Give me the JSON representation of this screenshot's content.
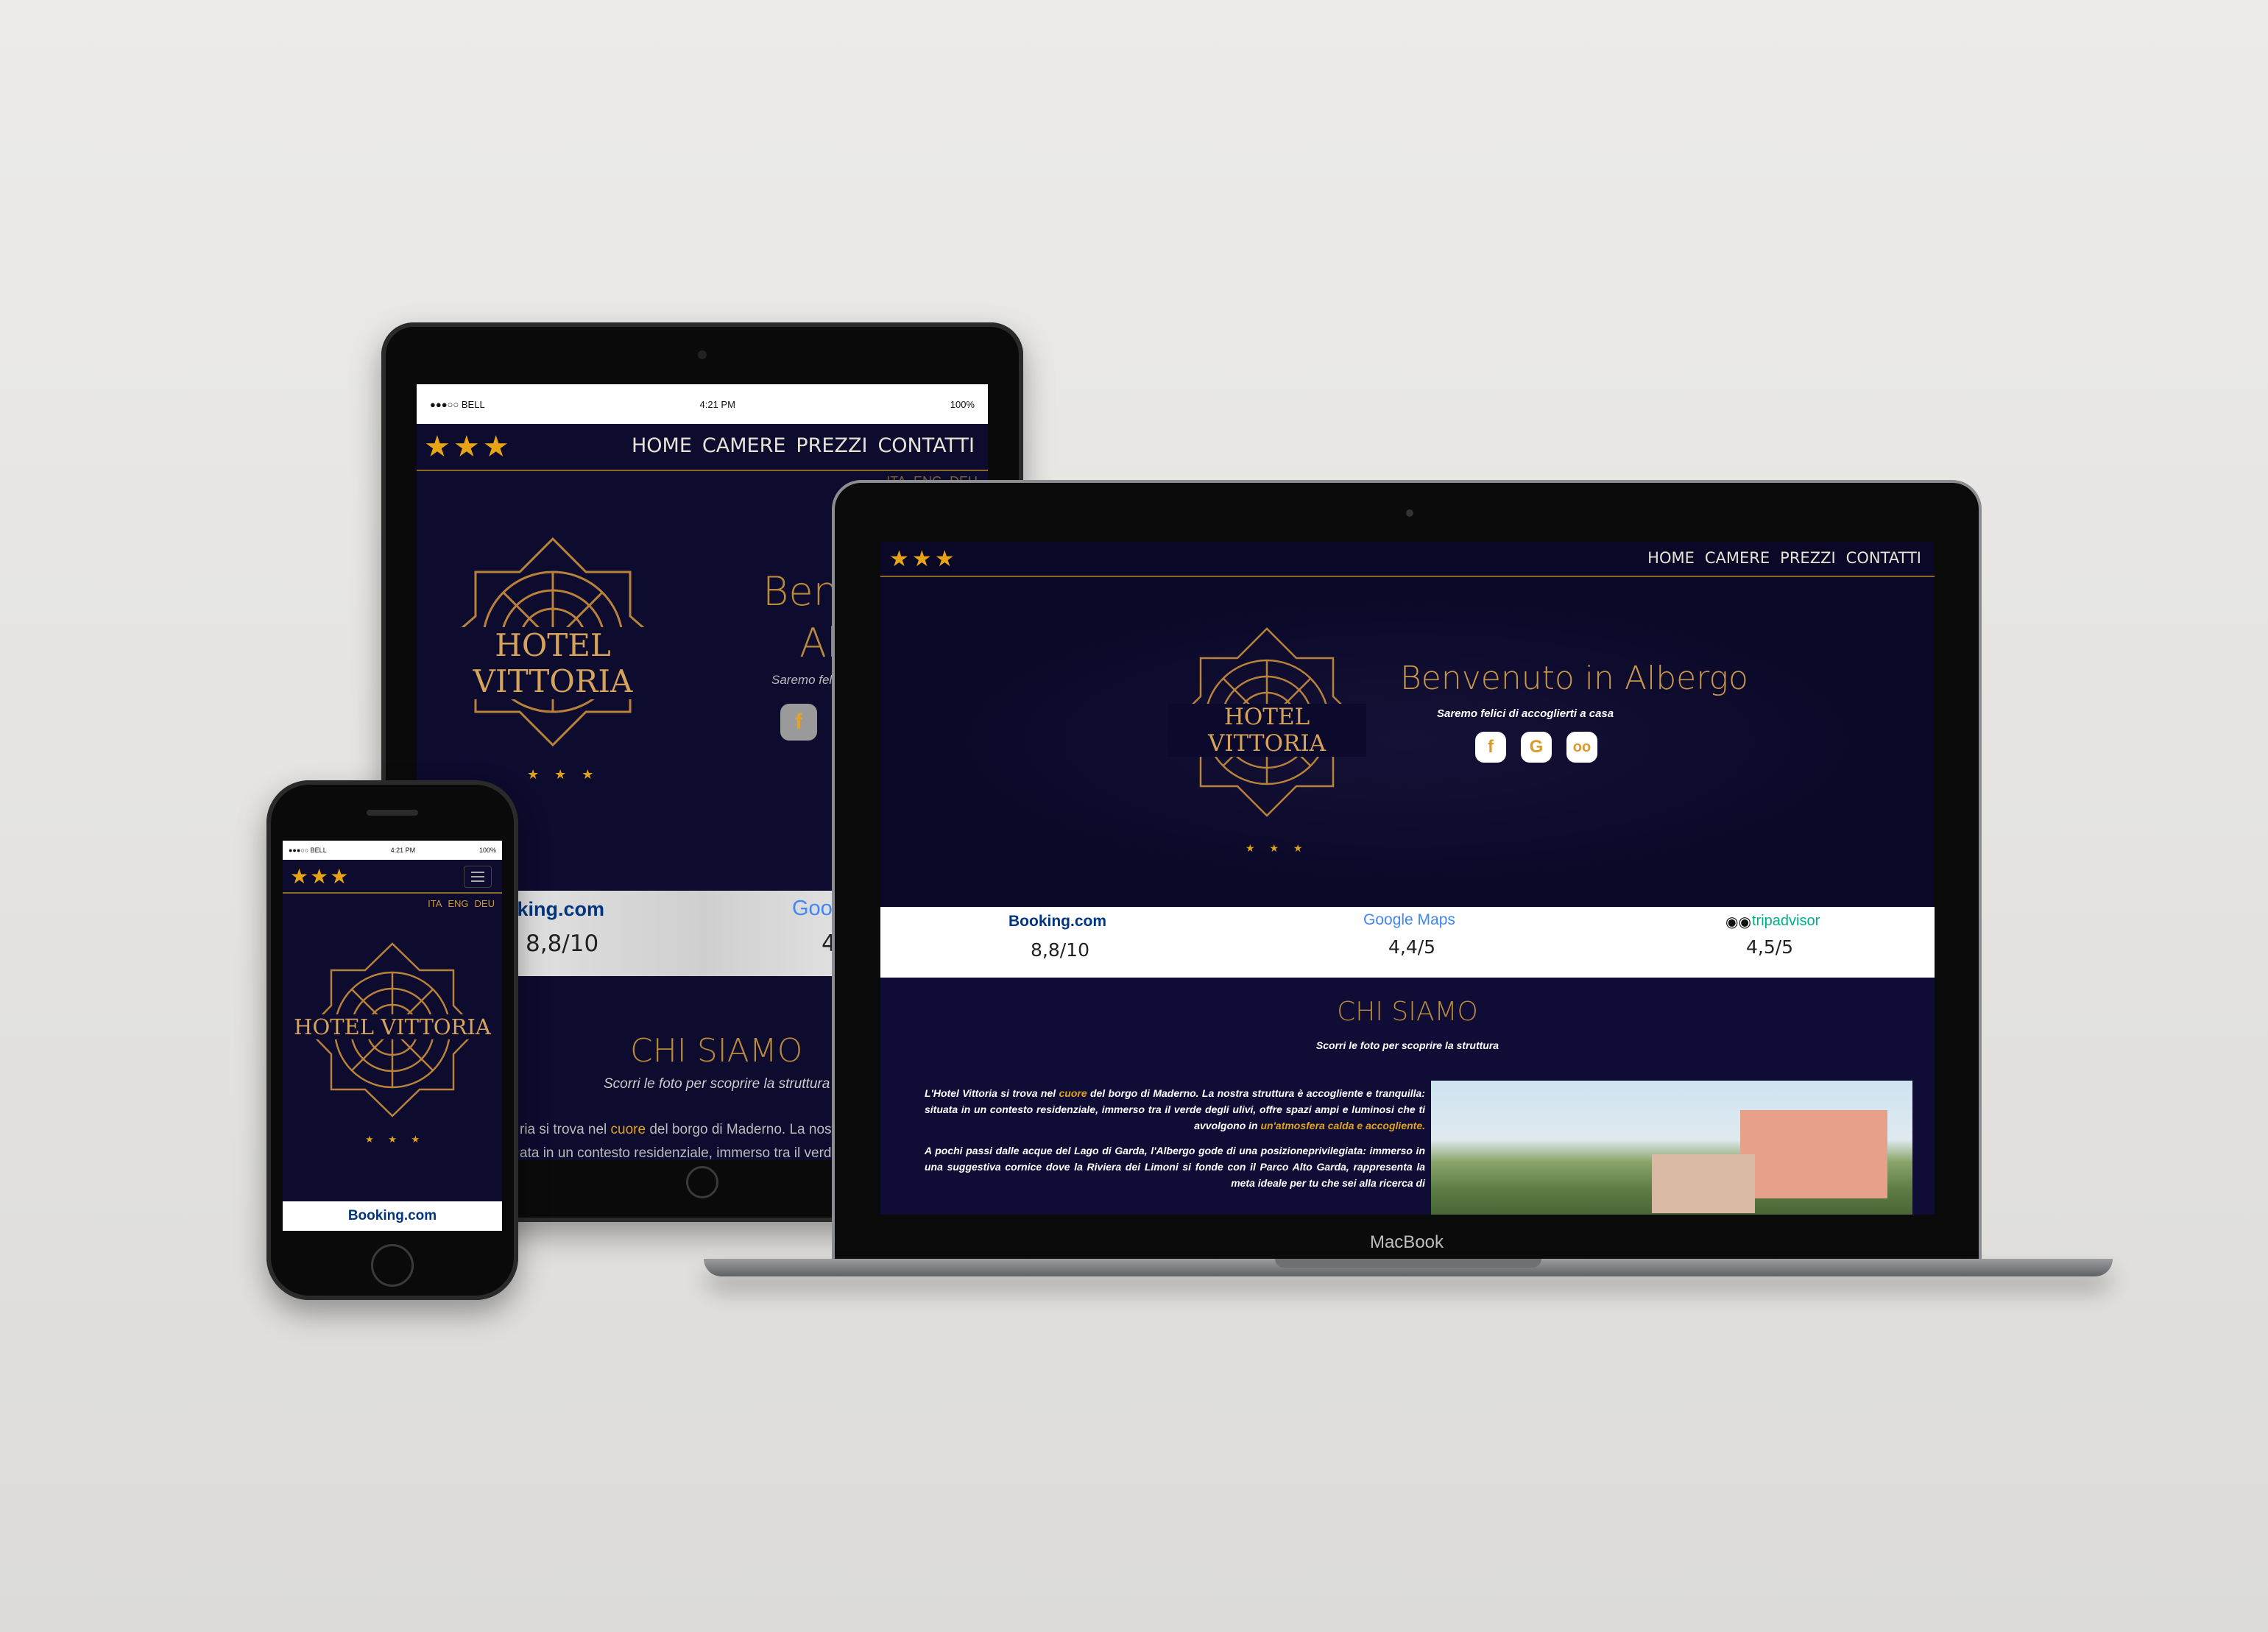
{
  "brand": {
    "name": "HOTEL VITTORIA",
    "stars": "★★★",
    "small_stars": "★ ★ ★"
  },
  "nav": {
    "home": "HOME",
    "rooms": "CAMERE",
    "prices": "PREZZI",
    "contacts": "CONTATTI"
  },
  "langs": {
    "ita": "ITA",
    "eng": "ENG",
    "deu": "DEU"
  },
  "hero": {
    "title": "Benvenuto in Albergo",
    "subtitle": "Saremo felici di accoglierti a casa"
  },
  "tablet_hero": {
    "title_frag1": "Benv",
    "title_frag2": "Al",
    "subtitle_frag": "Saremo felic"
  },
  "ratings": {
    "booking": {
      "label": "Booking.com",
      "value": "8,8/10"
    },
    "google": {
      "label": "Google Maps",
      "value": "4,4/5"
    },
    "tripadvisor": {
      "label": "tripadvisor",
      "value": "4,5/5"
    }
  },
  "tablet_ratings": {
    "booking_label": "oking.com",
    "booking_value": "8,8/10",
    "google_label": "Goo",
    "google_value": "4"
  },
  "about": {
    "title": "CHI SIAMO",
    "subtitle": "Scorri le foto per scoprire la struttura",
    "p1_a": "L'Hotel Vittoria si trova nel ",
    "p1_highlight": "cuore",
    "p1_b": " del borgo di Maderno. La nostra struttura è accogliente e tranquilla: situata in un contesto residenziale, immerso tra il verde degli ulivi, offre spazi ampi e luminosi che ti avvolgono in ",
    "p1_highlight2": "un'atmosfera calda e accogliente.",
    "p2": "A pochi passi dalle acque del Lago di Garda, l'Albergo gode di una posizioneprivilegiata: immerso in una suggestiva cornice dove la Riviera dei Limoni si fonde con il Parco Alto Garda, rappresenta la meta ideale per tu che sei alla ricerca di"
  },
  "tablet_about": {
    "line1_a": "ria si trova nel ",
    "line1_highlight": "cuore",
    "line1_b": " del borgo di Maderno. La nostra str",
    "line2": "ata in un contesto residenziale, immerso tra il verde degli"
  },
  "status_bar": {
    "carrier": "●●●○○ BELL",
    "time": "4:21 PM",
    "battery": "100%"
  },
  "phone_booking": "Booking.com",
  "macbook_label": "MacBook",
  "colors": {
    "navy": "#0d0b2e",
    "gold": "#e0a21b",
    "booking_blue": "#003580",
    "booking_cyan": "#0896ff"
  }
}
